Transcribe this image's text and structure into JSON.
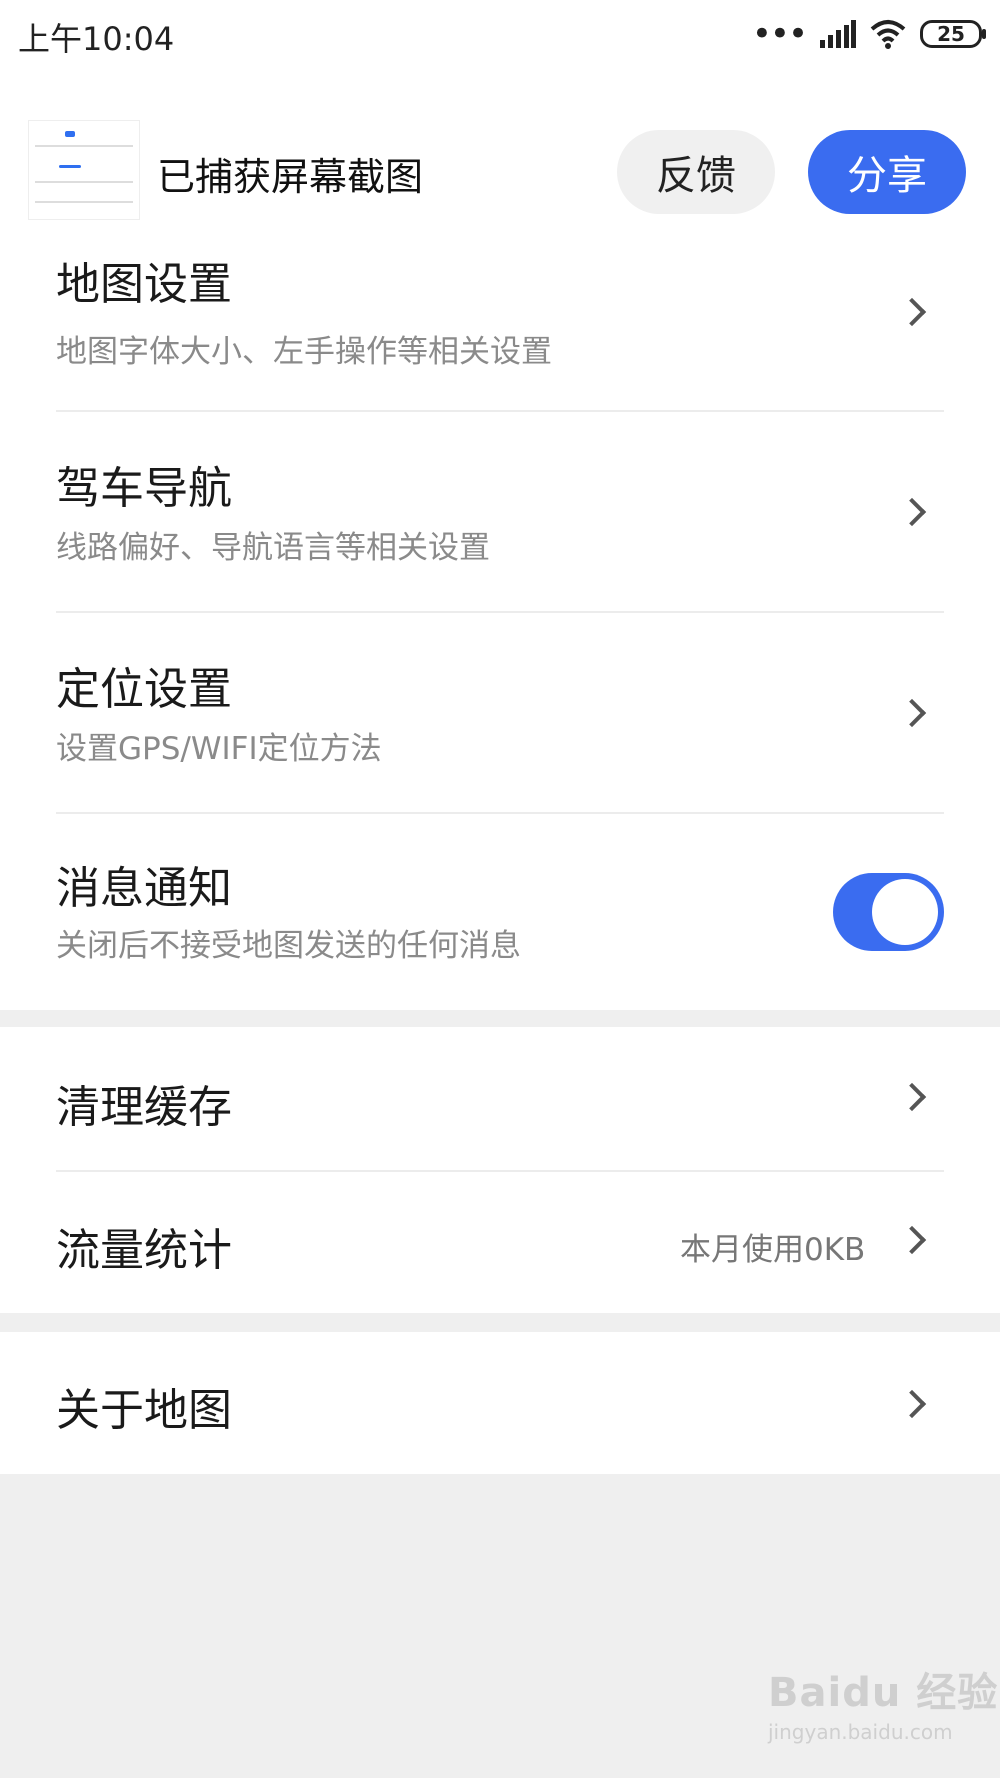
{
  "status_bar": {
    "time": "上午10:04",
    "signal_dots": "•••",
    "battery": "25"
  },
  "capture": {
    "title": "已捕获屏幕截图",
    "feedback_label": "反馈",
    "share_label": "分享"
  },
  "settings": {
    "map_settings": {
      "title": "地图设置",
      "subtitle": "地图字体大小、左手操作等相关设置"
    },
    "driving_nav": {
      "title": "驾车导航",
      "subtitle": "线路偏好、导航语言等相关设置"
    },
    "location": {
      "title": "定位设置",
      "subtitle": "设置GPS/WIFI定位方法"
    },
    "notifications": {
      "title": "消息通知",
      "subtitle": "关闭后不接受地图发送的任何消息",
      "toggle_on": true
    },
    "clear_cache": {
      "title": "清理缓存"
    },
    "traffic_stats": {
      "title": "流量统计",
      "value": "本月使用0KB"
    },
    "about": {
      "title": "关于地图"
    }
  },
  "watermark": {
    "brand": "Baidu 经验",
    "url": "jingyan.baidu.com"
  },
  "colors": {
    "accent": "#3a6cf0",
    "background": "#efefef"
  }
}
